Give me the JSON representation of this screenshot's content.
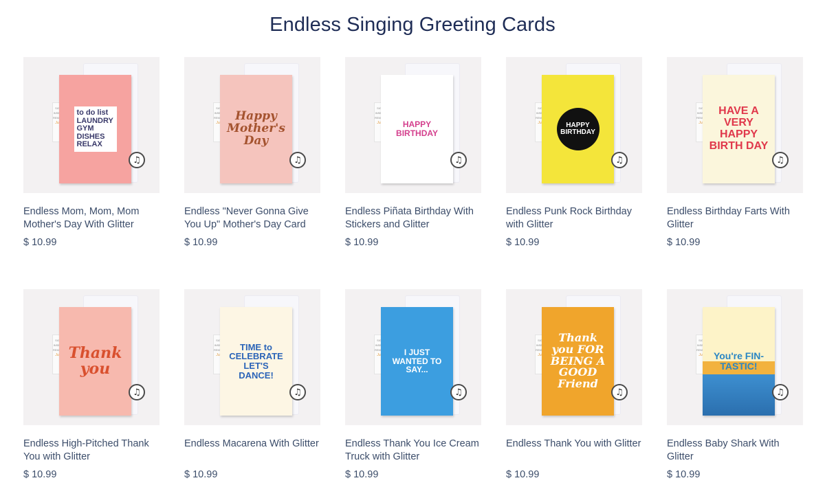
{
  "page": {
    "title": "Endless Singing Greeting Cards"
  },
  "products": [
    {
      "name": "Endless Mom, Mom, Mom Mother's Day With Glitter",
      "price": "$ 10.99",
      "card_text": "to do list LAUNDRY GYM DISHES RELAX",
      "card_bg": "#f6a3a0",
      "text_color": "#3a3a6a",
      "icon": "music-note-icon"
    },
    {
      "name": "Endless \"Never Gonna Give You Up\" Mother's Day Card",
      "price": "$ 10.99",
      "card_text": "Happy Mother's Day",
      "card_bg": "#f5c4bd",
      "text_color": "#a4532f",
      "icon": "music-note-icon"
    },
    {
      "name": "Endless Piñata Birthday With Stickers and Glitter",
      "price": "$ 10.99",
      "card_text": "HAPPY BIRTHDAY",
      "card_bg": "#ffffff",
      "text_color": "#d43f8d",
      "icon": "music-note-icon"
    },
    {
      "name": "Endless Punk Rock Birthday with Glitter",
      "price": "$ 10.99",
      "card_text": "HAPPY BIRTHDAY",
      "card_bg": "#f4e53a",
      "text_color": "#ffffff",
      "icon": "music-note-icon"
    },
    {
      "name": "Endless Birthday Farts With Glitter",
      "price": "$ 10.99",
      "card_text": "HAVE A VERY HAPPY BIRTH DAY",
      "card_bg": "#fbf6dc",
      "text_color": "#e0384b",
      "icon": "music-note-icon"
    },
    {
      "name": "Endless High-Pitched Thank You with Glitter",
      "price": "$ 10.99",
      "card_text": "Thank you",
      "card_bg": "#f7b9ae",
      "text_color": "#d9502e",
      "icon": "music-note-icon"
    },
    {
      "name": "Endless Macarena With Glitter",
      "price": "$ 10.99",
      "card_text": "TIME to CELEBRATE LET'S DANCE!",
      "card_bg": "#fdf6e4",
      "text_color": "#2b64b8",
      "icon": "music-note-icon"
    },
    {
      "name": "Endless Thank You Ice Cream Truck with Glitter",
      "price": "$ 10.99",
      "card_text": "I JUST WANTED TO SAY...",
      "card_bg": "#3c9ee0",
      "text_color": "#ffffff",
      "icon": "music-note-icon"
    },
    {
      "name": "Endless Thank You with Glitter",
      "price": "$ 10.99",
      "card_text": "Thank you FOR BEING A GOOD Friend",
      "card_bg": "#f0a52c",
      "text_color": "#ffffff",
      "icon": "music-note-icon"
    },
    {
      "name": "Endless Baby Shark With Glitter",
      "price": "$ 10.99",
      "card_text": "You're FIN-TASTIC!",
      "card_bg": "#fdf3c8",
      "text_color": "#2a86c4",
      "icon": "music-note-icon"
    }
  ]
}
